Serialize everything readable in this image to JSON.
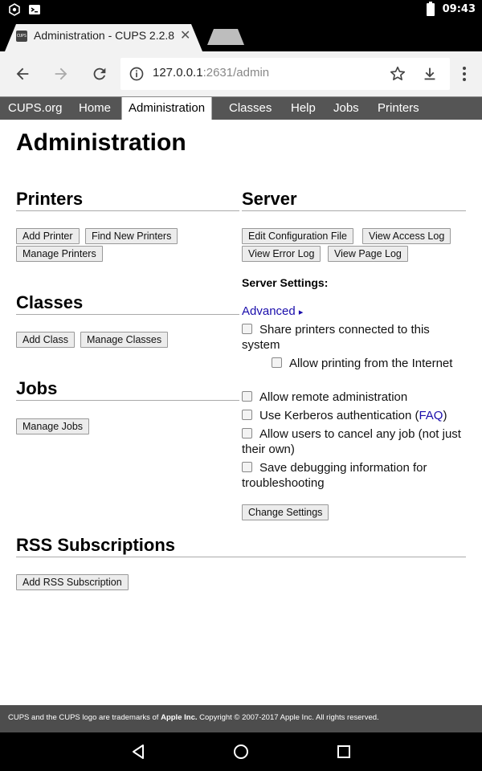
{
  "status_bar": {
    "time": "09:43"
  },
  "tab": {
    "title": "Administration - CUPS 2.2.8",
    "favicon_text": "CUPS",
    "close_glyph": "✕"
  },
  "omnibox": {
    "host": "127.0.0.1",
    "port_path": ":2631/admin"
  },
  "cups_nav": [
    {
      "label": "CUPS.org"
    },
    {
      "label": "Home"
    },
    {
      "label": "Administration",
      "active": true
    },
    {
      "label": "Classes"
    },
    {
      "label": "Help"
    },
    {
      "label": "Jobs"
    },
    {
      "label": "Printers"
    }
  ],
  "page": {
    "title": "Administration",
    "printers": {
      "heading": "Printers",
      "add": "Add Printer",
      "find": "Find New Printers",
      "manage": "Manage Printers"
    },
    "classes": {
      "heading": "Classes",
      "add": "Add Class",
      "manage": "Manage Classes"
    },
    "jobs": {
      "heading": "Jobs",
      "manage": "Manage Jobs"
    },
    "rss": {
      "heading": "RSS Subscriptions",
      "add": "Add RSS Subscription"
    },
    "server": {
      "heading": "Server",
      "edit_config": "Edit Configuration File",
      "access_log": "View Access Log",
      "error_log": "View Error Log",
      "page_log": "View Page Log",
      "settings_label": "Server Settings:",
      "advanced": "Advanced",
      "advanced_arrow": "▸",
      "share": "Share printers connected to this system",
      "allow_internet": "Allow printing from the Internet",
      "remote_admin": "Allow remote administration",
      "kerberos": "Use Kerberos authentication (",
      "faq": "FAQ",
      "kerberos_end": ")",
      "cancel_any": "Allow users to cancel any job (not just their own)",
      "debug": "Save debugging information for troubleshooting",
      "change": "Change Settings"
    }
  },
  "footer": {
    "pre": "CUPS and the CUPS logo are trademarks of ",
    "apple": "Apple Inc.",
    "post": " Copyright © 2007-2017 Apple Inc. All rights reserved."
  }
}
